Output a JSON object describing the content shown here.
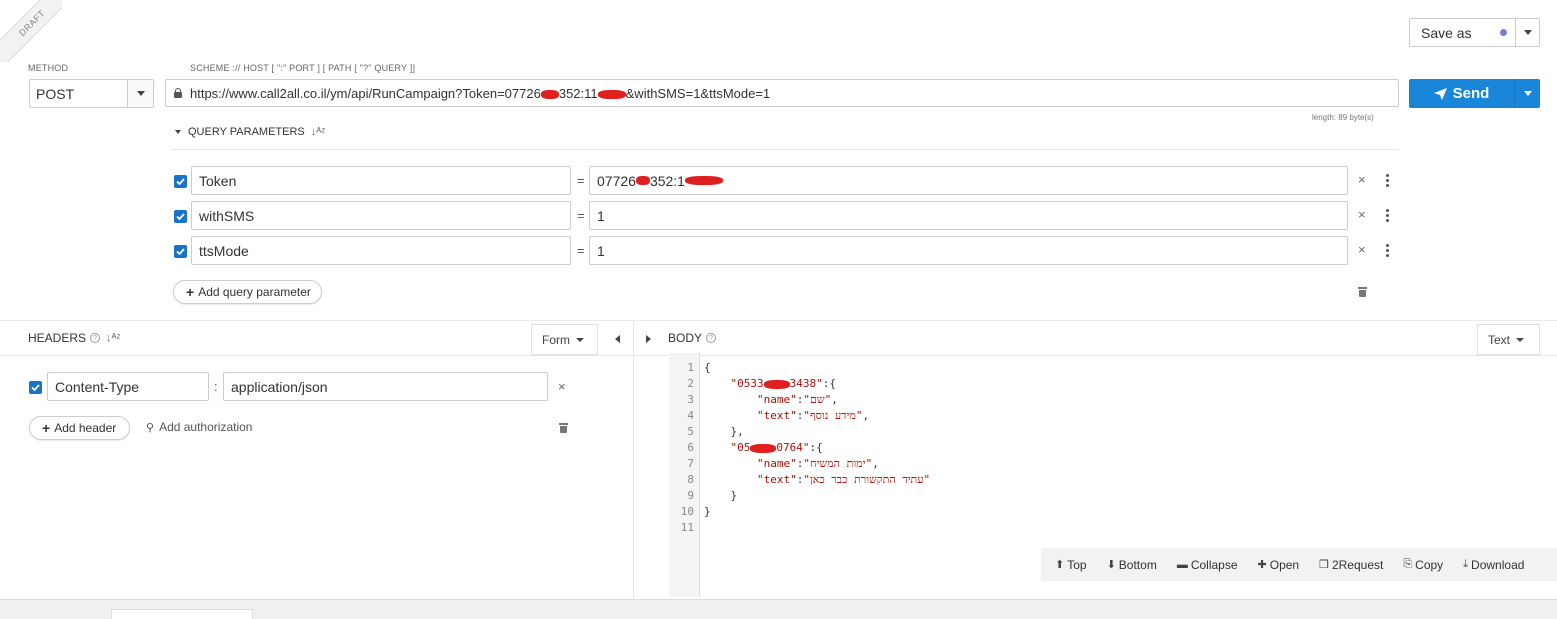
{
  "draft_label": "DRAFT",
  "save_as": {
    "label": "Save as",
    "dot_color": "#7b7bd6"
  },
  "method": {
    "label": "METHOD",
    "value": "POST"
  },
  "url": {
    "label": "SCHEME :// HOST [ \":\" PORT ] [ PATH [ \"?\" QUERY ]]",
    "value_prefix": "https://www.call2all.co.il/ym/api/RunCampaign?Token=07726",
    "value_mid": "352:11",
    "value_suffix": "&withSMS=1&ttsMode=1",
    "length": "length: 89 byte(s)"
  },
  "send": {
    "label": "Send",
    "color": "#1a86d9"
  },
  "query": {
    "title": "QUERY PARAMETERS",
    "sort_icon": "sort-alpha-icon",
    "params": [
      {
        "name": "Token",
        "value": "07726",
        "value_tail": "352:1",
        "redacted": true
      },
      {
        "name": "withSMS",
        "value": "1",
        "value_tail": "",
        "redacted": false
      },
      {
        "name": "ttsMode",
        "value": "1",
        "value_tail": "",
        "redacted": false
      }
    ],
    "add_label": "Add query parameter"
  },
  "headers": {
    "title": "HEADERS",
    "mode": "Form",
    "items": [
      {
        "name": "Content-Type",
        "value": "application/json"
      }
    ],
    "add_label": "Add header",
    "auth_label": "Add authorization"
  },
  "body": {
    "title": "BODY",
    "mode": "Text",
    "line_numbers": [
      "1",
      "2",
      "3",
      "4",
      "5",
      "6",
      "7",
      "8",
      "9",
      "10",
      "11"
    ],
    "lines": [
      {
        "parts": [
          {
            "t": "{",
            "c": ""
          }
        ]
      },
      {
        "parts": [
          {
            "t": "    \"0533",
            "c": "key"
          },
          {
            "t": "REDACT",
            "c": "red"
          },
          {
            "t": "3438\"",
            "c": "key"
          },
          {
            "t": ":{",
            "c": ""
          }
        ]
      },
      {
        "parts": [
          {
            "t": "        \"name\"",
            "c": "key"
          },
          {
            "t": ":",
            "c": ""
          },
          {
            "t": "\"שם\"",
            "c": "str"
          },
          {
            "t": ",",
            "c": ""
          }
        ]
      },
      {
        "parts": [
          {
            "t": "        \"text\"",
            "c": "key"
          },
          {
            "t": ":",
            "c": ""
          },
          {
            "t": "\"מידע נוסף\"",
            "c": "str"
          },
          {
            "t": ",",
            "c": ""
          }
        ]
      },
      {
        "parts": [
          {
            "t": "    },",
            "c": ""
          }
        ]
      },
      {
        "parts": [
          {
            "t": "    \"05",
            "c": "key"
          },
          {
            "t": "REDACT",
            "c": "red"
          },
          {
            "t": "0764\"",
            "c": "key"
          },
          {
            "t": ":{",
            "c": ""
          }
        ]
      },
      {
        "parts": [
          {
            "t": "        \"name\"",
            "c": "key"
          },
          {
            "t": ":",
            "c": ""
          },
          {
            "t": "\"ימות המשיח\"",
            "c": "str"
          },
          {
            "t": ",",
            "c": ""
          }
        ]
      },
      {
        "parts": [
          {
            "t": "        \"text\"",
            "c": "key"
          },
          {
            "t": ":",
            "c": ""
          },
          {
            "t": "\"עתיד התקשורת כבר כאן\"",
            "c": "str"
          }
        ]
      },
      {
        "parts": [
          {
            "t": "    }",
            "c": ""
          }
        ]
      },
      {
        "parts": [
          {
            "t": "}",
            "c": ""
          }
        ]
      },
      {
        "parts": [
          {
            "t": "",
            "c": ""
          }
        ]
      }
    ]
  },
  "editor_toolbar": [
    {
      "label": "Top",
      "icon": "arrow-up-circle-icon",
      "glyph": "⬆"
    },
    {
      "label": "Bottom",
      "icon": "arrow-down-circle-icon",
      "glyph": "⬇"
    },
    {
      "label": "Collapse",
      "icon": "minus-square-icon",
      "glyph": "▬"
    },
    {
      "label": "Open",
      "icon": "plus-square-icon",
      "glyph": "✚"
    },
    {
      "label": "2Request",
      "icon": "copy-request-icon",
      "glyph": "❐"
    },
    {
      "label": "Copy",
      "icon": "copy-icon",
      "glyph": "⎘"
    },
    {
      "label": "Download",
      "icon": "download-icon",
      "glyph": "⤓"
    }
  ]
}
